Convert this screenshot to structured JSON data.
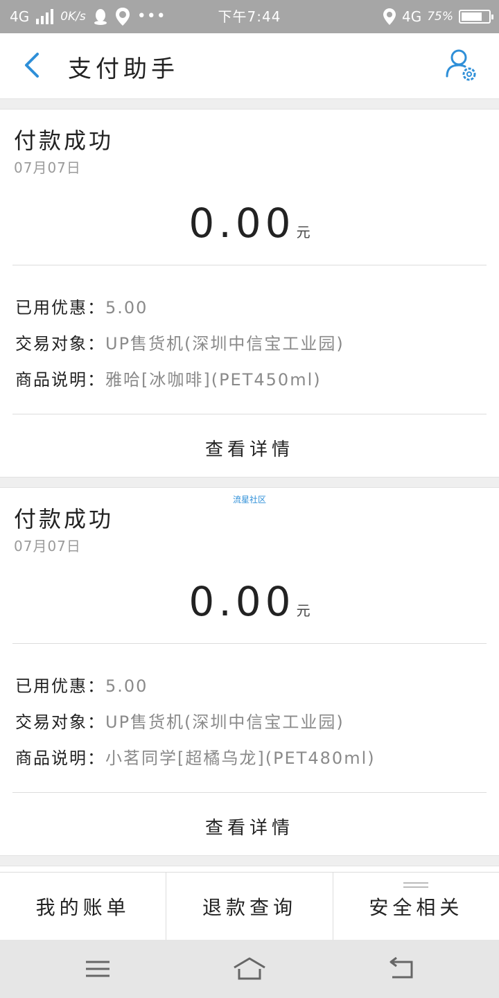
{
  "status_bar": {
    "network": "4G",
    "speed": "0K/s",
    "time": "下午7:44",
    "network_right": "4G",
    "battery": "75%",
    "battery_level": 0.75
  },
  "header": {
    "title": "支付助手"
  },
  "cards": [
    {
      "title": "付款成功",
      "date": "07月07日",
      "amount": "0.00",
      "currency": "元",
      "rows": [
        {
          "label": "已用优惠：",
          "value": "5.00"
        },
        {
          "label": "交易对象：",
          "value": "UP售货机(深圳中信宝工业园)"
        },
        {
          "label": "商品说明：",
          "value": "雅哈[冰咖啡](PET450ml)"
        }
      ],
      "detail_link": "查看详情"
    },
    {
      "title": "付款成功",
      "date": "07月07日",
      "amount": "0.00",
      "currency": "元",
      "rows": [
        {
          "label": "已用优惠：",
          "value": "5.00"
        },
        {
          "label": "交易对象：",
          "value": "UP售货机(深圳中信宝工业园)"
        },
        {
          "label": "商品说明：",
          "value": "小茗同学[超橘乌龙](PET480ml)"
        }
      ],
      "detail_link": "查看详情"
    }
  ],
  "watermark": "流星社区",
  "tabs": [
    "我的账单",
    "退款查询",
    "安全相关"
  ],
  "colors": {
    "accent": "#2e8fd8",
    "status_bar": "#a6a6a6"
  }
}
